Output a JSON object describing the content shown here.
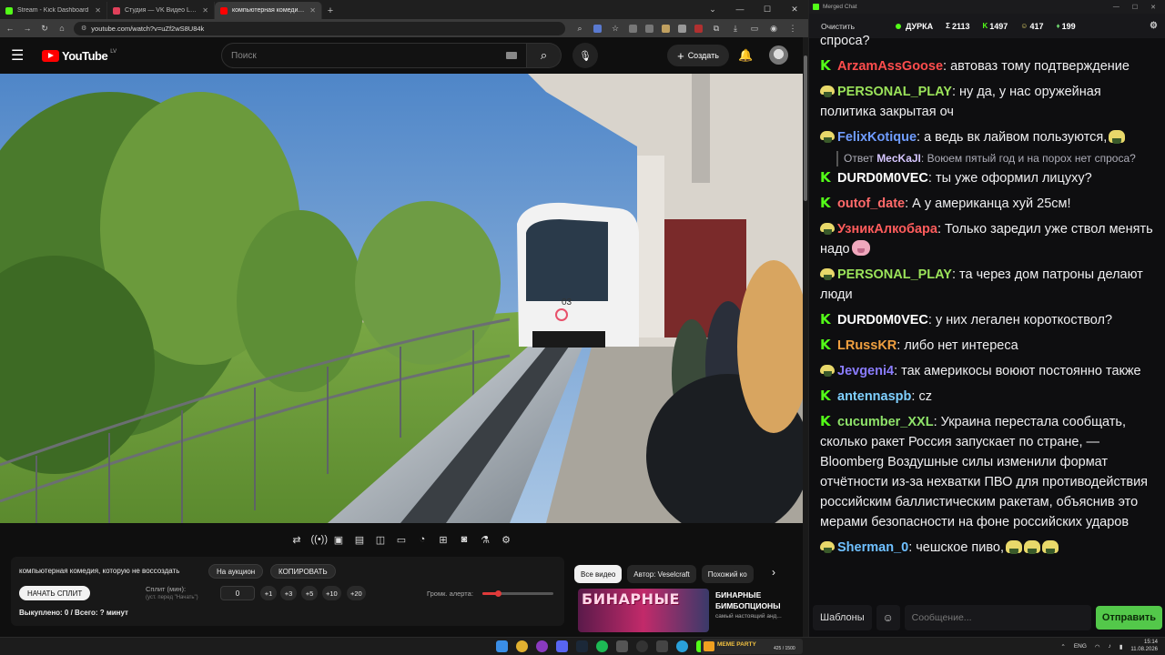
{
  "browser": {
    "tabs": [
      {
        "label": "Stream - Kick Dashboard",
        "color": "#53fc18",
        "active": false
      },
      {
        "label": "Студия — VK Видео Live",
        "color": "#e0405a",
        "active": false
      },
      {
        "label": "компьютерная комедия, которую не воссоздать",
        "color": "#ff0000",
        "active": true
      }
    ],
    "new_tab": "+",
    "url": "youtube.com/watch?v=uZf2wS8U84k"
  },
  "youtube": {
    "logo": "YouTube",
    "region": "LV",
    "search_placeholder": "Поиск",
    "create_label": "Создать"
  },
  "controls": {
    "icons": [
      "repeat-icon",
      "broadcast-icon",
      "clip-icon",
      "film-icon",
      "frame-icon",
      "layout-icon",
      "speed-icon",
      "add-icon",
      "camera-icon",
      "flask-icon",
      "settings-icon"
    ]
  },
  "alert_panel": {
    "title": "компьютерная комедия, которую не воссоздать",
    "auction_label": "На аукцион",
    "copy_label": "КОПИРОВАТЬ",
    "start_split_label": "НАЧАТЬ СПЛИТ",
    "split_label": "Сплит (мин):",
    "split_hint": "(уст. перед \"Начать\")",
    "split_value": "0",
    "increments": [
      "+1",
      "+3",
      "+5",
      "+10",
      "+20"
    ],
    "volume_label": "Громк. алерта:",
    "volume_fraction": 0.22,
    "bought": "Выкуплено: 0 / Всего: ? минут"
  },
  "related": {
    "chips": [
      {
        "label": "Все видео",
        "active": true
      },
      {
        "label": "Автор: Veselcraft",
        "active": false
      },
      {
        "label": "Похожий ко",
        "active": false
      }
    ],
    "thumb_text": "БИНАРНЫЕ",
    "title": "БИНАРНЫЕ БИМБОПЦИОНЫ",
    "desc": "самый настоящий анд..."
  },
  "chat": {
    "window_title": "Merged Chat",
    "clear_label": "Очистить",
    "channel": "ДУРКА",
    "stats": [
      {
        "icon": "Σ",
        "value": "2113"
      },
      {
        "icon": "K",
        "value": "1497"
      },
      {
        "icon": "☺",
        "value": "417"
      },
      {
        "icon": "♦",
        "value": "199"
      }
    ],
    "messages": [
      {
        "platform": "",
        "user": "",
        "color": "#efeff1",
        "text": "спроса?",
        "continuation": true
      },
      {
        "platform": "kick",
        "user": "ArzamAssGoose",
        "color": "#ff4d4d",
        "text": "автоваз тому подтверждение"
      },
      {
        "platform": "twitch",
        "user": "PERSONAL_PLAY",
        "color": "#9be35a",
        "text": "ну да, у нас оружейная политика закрытая оч"
      },
      {
        "platform": "twitch",
        "user": "FelixKotique",
        "color": "#6f9cff",
        "text": "а ведь вк лайвом пользуются,",
        "emote": "twitch"
      },
      {
        "platform": "reply",
        "reply_prefix": "Ответ",
        "reply_user": "MecKaJI",
        "reply_text": "Воюем пятый год и на порох нет спроса?"
      },
      {
        "platform": "kick",
        "user": "DURD0M0VEC",
        "color": "#ffffff",
        "text": "ты уже оформил лицуху?"
      },
      {
        "platform": "kick",
        "user": "outof_date",
        "color": "#ff6a6a",
        "text": "А у американца хуй 25см!"
      },
      {
        "platform": "twitch",
        "user": "УзникАлкобара",
        "color": "#ff5c5c",
        "text": "Только заредил уже ствол менять надо",
        "emote": "pig"
      },
      {
        "platform": "twitch",
        "user": "PERSONAL_PLAY",
        "color": "#9be35a",
        "text": "та через дом патроны делают люди"
      },
      {
        "platform": "kick",
        "user": "DURD0M0VEC",
        "color": "#ffffff",
        "text": "у них легален короткоствол?"
      },
      {
        "platform": "kick",
        "user": "LRussKR",
        "color": "#f0a040",
        "text": "либо нет интереса"
      },
      {
        "platform": "twitch",
        "user": "Jevgeni4",
        "color": "#8a7cff",
        "text": "так америкосы воюют постоянно также"
      },
      {
        "platform": "kick",
        "user": "antennaspb",
        "color": "#7fd0ff",
        "text": "cz"
      },
      {
        "platform": "kick",
        "user": "cucumber_XXL",
        "color": "#8fe36a",
        "text": "Украина перестала сообщать, сколько ракет Россия запускает по стране, — Bloomberg Воздушные силы изменили формат отчётности из-за нехватки ПВО для противодействия российским баллистическим ракетам, объяснив это мерами безопасности на фоне российских ударов"
      },
      {
        "platform": "twitch",
        "user": "Sherman_0",
        "color": "#6fc0ff",
        "text": "чешское пиво,",
        "emote": "twitch3"
      }
    ],
    "templates_label": "Шаблоны",
    "input_placeholder": "Сообщение...",
    "send_label": "Отправить"
  },
  "taskbar": {
    "widget_text": "MEME PARTY",
    "widget_count": "425 / 1500",
    "lang": "ENG",
    "time": "15:14",
    "date": "11.08.2026"
  },
  "colors": {
    "kick_green": "#53fc18",
    "youtube_red": "#ff0000",
    "send_green": "#53c84a",
    "volume_red": "#e03a3a"
  }
}
